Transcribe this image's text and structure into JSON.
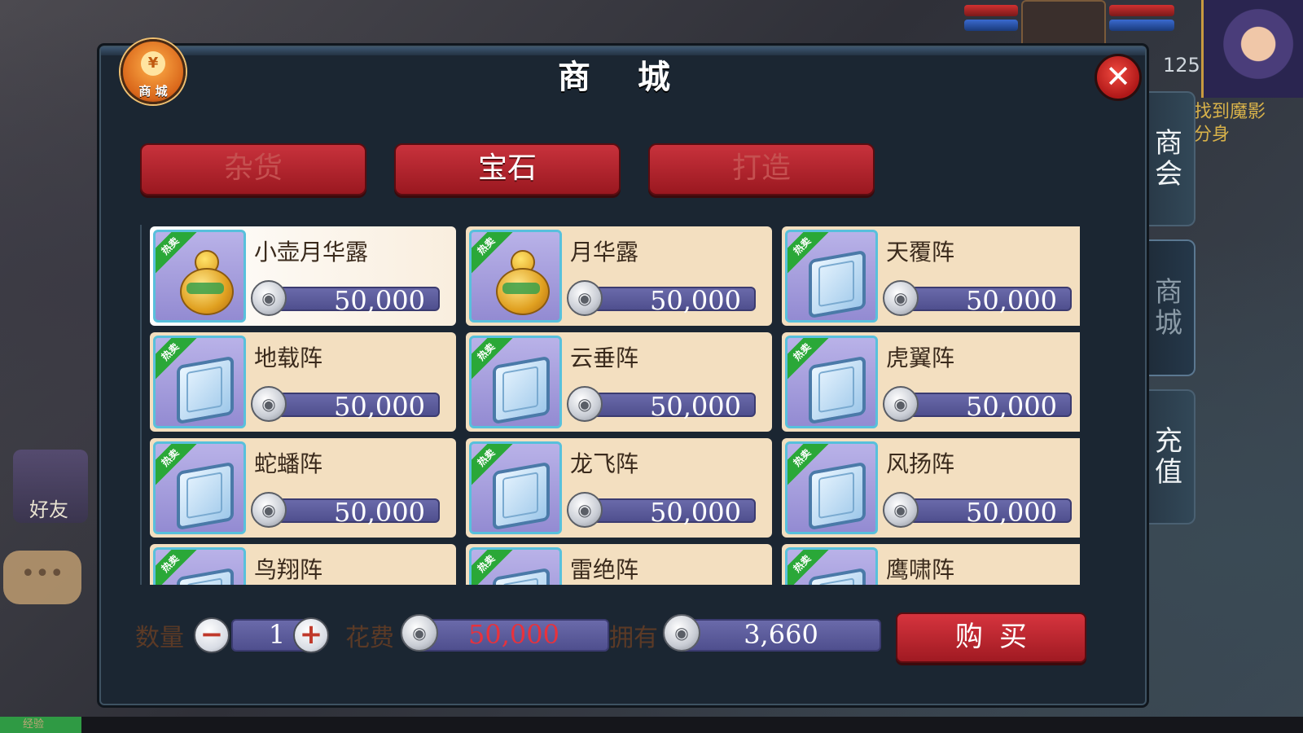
{
  "hud": {
    "level": "125",
    "quest_text": "找到魔影\n分身"
  },
  "side_tabs": [
    {
      "label": "商\n会"
    },
    {
      "label": "商\n城"
    },
    {
      "label": "充\n值"
    }
  ],
  "dialog": {
    "title": "商 城",
    "badge_coin": "¥",
    "badge_label": "商 城",
    "close_symbol": "✕"
  },
  "categories": [
    {
      "label": "杂货",
      "active": false
    },
    {
      "label": "宝石",
      "active": true
    },
    {
      "label": "打造",
      "active": false
    }
  ],
  "items": [
    {
      "name": "小壶月华露",
      "price": "50,000",
      "hot_tag": "热卖",
      "icon": "gourd-icon",
      "selected": true
    },
    {
      "name": "月华露",
      "price": "50,000",
      "hot_tag": "热卖",
      "icon": "gourd-icon"
    },
    {
      "name": "天覆阵",
      "price": "50,000",
      "hot_tag": "热卖",
      "icon": "book-icon"
    },
    {
      "name": "地载阵",
      "price": "50,000",
      "hot_tag": "热卖",
      "icon": "book-icon"
    },
    {
      "name": "云垂阵",
      "price": "50,000",
      "hot_tag": "热卖",
      "icon": "book-icon"
    },
    {
      "name": "虎翼阵",
      "price": "50,000",
      "hot_tag": "热卖",
      "icon": "book-icon"
    },
    {
      "name": "蛇蟠阵",
      "price": "50,000",
      "hot_tag": "热卖",
      "icon": "book-icon"
    },
    {
      "name": "龙飞阵",
      "price": "50,000",
      "hot_tag": "热卖",
      "icon": "book-icon"
    },
    {
      "name": "风扬阵",
      "price": "50,000",
      "hot_tag": "热卖",
      "icon": "book-icon"
    },
    {
      "name": "鸟翔阵",
      "price": "",
      "hot_tag": "热卖",
      "icon": "book-icon"
    },
    {
      "name": "雷绝阵",
      "price": "",
      "hot_tag": "热卖",
      "icon": "book-icon"
    },
    {
      "name": "鹰啸阵",
      "price": "",
      "hot_tag": "热卖",
      "icon": "book-icon"
    }
  ],
  "purchase": {
    "qty_label": "数量",
    "quantity": "1",
    "minus": "−",
    "plus": "+",
    "cost_label": "花费",
    "cost": "50,000",
    "own_label": "拥有",
    "owned": "3,660",
    "buy_label": "购买"
  },
  "left_buttons": {
    "friend": "好友",
    "chat": "•••"
  },
  "exp_label": "经验",
  "colors": {
    "cost_text": "#e8323c",
    "owned_text": "#ffffff",
    "item_bg": "#f3dfc0",
    "button_red": "#b0222c"
  }
}
